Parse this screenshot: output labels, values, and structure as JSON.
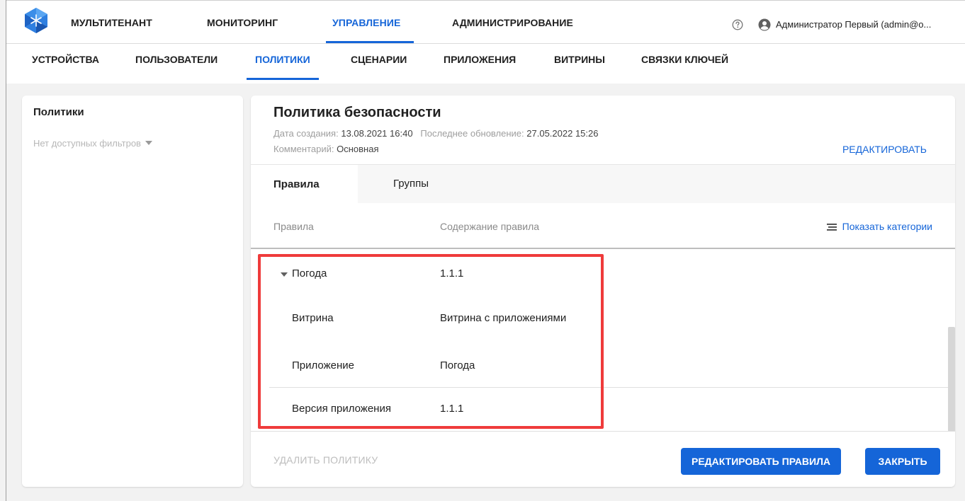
{
  "top_nav": {
    "items": [
      "МУЛЬТИТЕНАНТ",
      "МОНИТОРИНГ",
      "УПРАВЛЕНИЕ",
      "АДМИНИСТРИРОВАНИЕ"
    ],
    "active": "УПРАВЛЕНИЕ",
    "user_name": "Администратор Первый (admin@o...",
    "help_icon": "help-circle-icon",
    "user_icon": "account-circle-icon",
    "accent_color": "#1565d8"
  },
  "sub_nav": {
    "items": [
      "УСТРОЙСТВА",
      "ПОЛЬЗОВАТЕЛИ",
      "ПОЛИТИКИ",
      "СЦЕНАРИИ",
      "ПРИЛОЖЕНИЯ",
      "ВИТРИНЫ",
      "СВЯЗКИ КЛЮЧЕЙ"
    ],
    "active": "ПОЛИТИКИ"
  },
  "sidebar": {
    "title": "Политики",
    "filter_label": "Нет доступных фильтров"
  },
  "policy": {
    "title": "Политика безопасности",
    "created_label": "Дата создания:",
    "created_value": "13.08.2021 16:40",
    "updated_label": "Последнее обновление:",
    "updated_value": "27.05.2022 15:26",
    "comment_label": "Комментарий:",
    "comment_value": "Основная",
    "edit_label": "РЕДАКТИРОВАТЬ"
  },
  "tabs": [
    "Правила",
    "Группы"
  ],
  "active_tab": "Правила",
  "table": {
    "col_rules": "Правила",
    "col_content": "Содержание правила",
    "show_categories": "Показать категории",
    "group": {
      "name": "Погода",
      "value": "1.1.1",
      "expanded": true
    },
    "rows": [
      {
        "name": "Витрина",
        "value": "Витрина с приложениями"
      },
      {
        "name": "Приложение",
        "value": "Погода"
      },
      {
        "name": "Версия приложения",
        "value": "1.1.1"
      }
    ]
  },
  "footer": {
    "delete_label": "УДАЛИТЬ ПОЛИТИКУ",
    "edit_rules_label": "РЕДАКТИРОВАТЬ ПРАВИЛА",
    "close_label": "ЗАКРЫТЬ"
  },
  "colors": {
    "accent": "#1565d8",
    "highlight": "#ef3b3b"
  }
}
